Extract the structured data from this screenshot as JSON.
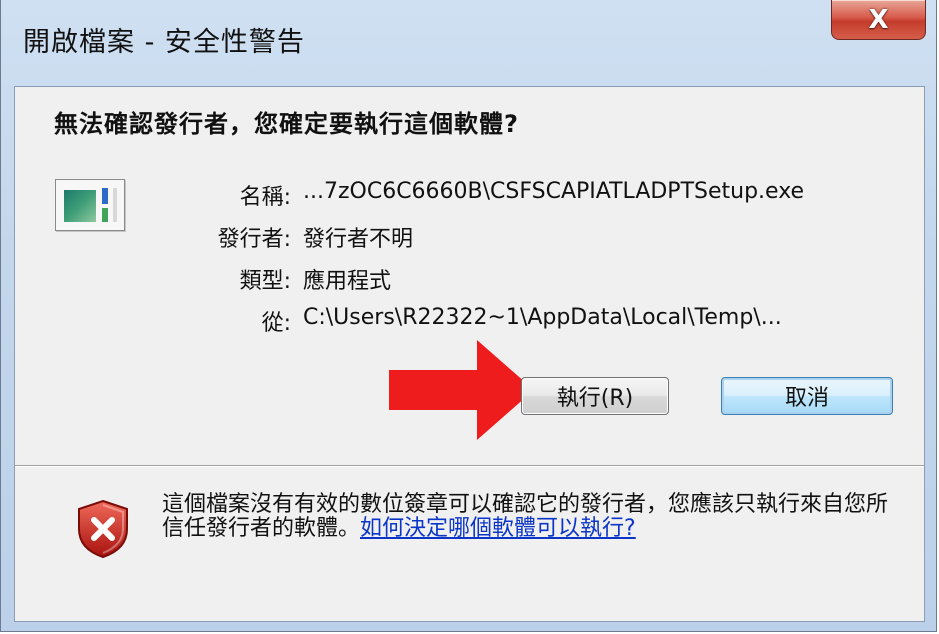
{
  "window": {
    "title": "開啟檔案 - 安全性警告",
    "close_label": "X"
  },
  "dialog": {
    "question": "無法確認發行者，您確定要執行這個軟體?",
    "app_icon": "application-window-icon",
    "fields": {
      "name_label": "名稱:",
      "name_value": "...7zOC6C6660B\\CSFSCAPIATLADPTSetup.exe",
      "publisher_label": "發行者:",
      "publisher_value": "發行者不明",
      "type_label": "類型:",
      "type_value": "應用程式",
      "from_label": "從:",
      "from_value": "C:\\Users\\R22322~1\\AppData\\Local\\Temp\\..."
    },
    "buttons": {
      "run_label": "執行(R)",
      "cancel_label": "取消"
    },
    "annotation": {
      "arrow_color": "#ee1c1c"
    }
  },
  "footer": {
    "shield_icon": "security-shield-error-icon",
    "warning_text": "這個檔案沒有有效的數位簽章可以確認它的發行者，您應該只執行來自您所信任發行者的軟體。",
    "help_link": "如何決定哪個軟體可以執行?"
  },
  "colors": {
    "link": "#0b35c8",
    "shield_red": "#c8231e",
    "frame": "#c3d6ec"
  }
}
